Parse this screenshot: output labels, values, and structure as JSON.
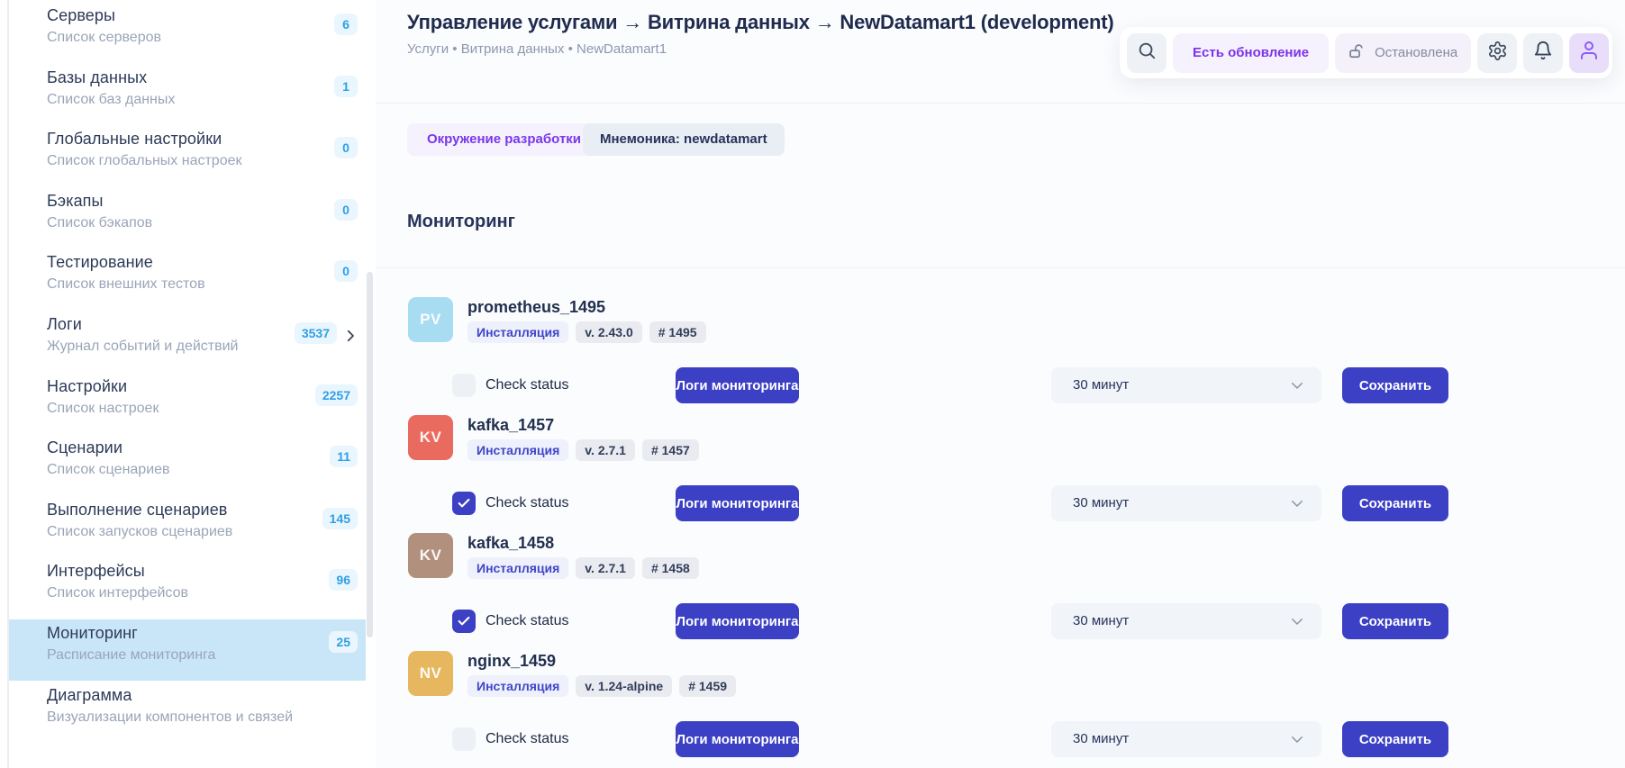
{
  "sidebar": {
    "items": [
      {
        "title": "Серверы",
        "subtitle": "Список серверов",
        "badge": "6"
      },
      {
        "title": "Базы данных",
        "subtitle": "Список баз данных",
        "badge": "1"
      },
      {
        "title": "Глобальные настройки",
        "subtitle": "Список глобальных настроек",
        "badge": "0"
      },
      {
        "title": "Бэкапы",
        "subtitle": "Список бэкапов",
        "badge": "0"
      },
      {
        "title": "Тестирование",
        "subtitle": "Список внешних тестов",
        "badge": "0"
      },
      {
        "title": "Логи",
        "subtitle": "Журнал событий и действий",
        "badge": "3537",
        "has_chevron": true
      },
      {
        "title": "Настройки",
        "subtitle": "Список настроек",
        "badge": "2257"
      },
      {
        "title": "Сценарии",
        "subtitle": "Список сценариев",
        "badge": "11"
      },
      {
        "title": "Выполнение сценариев",
        "subtitle": "Список запусков сценариев",
        "badge": "145"
      },
      {
        "title": "Интерфейсы",
        "subtitle": "Список интерфейсов",
        "badge": "96"
      },
      {
        "title": "Мониторинг",
        "subtitle": "Расписание мониторинга",
        "badge": "25",
        "selected": true
      },
      {
        "title": "Диаграмма",
        "subtitle": "Визуализации компонентов и связей",
        "badge": ""
      }
    ]
  },
  "header": {
    "title": "Управление услугами → Витрина данных → NewDatamart1 (development)",
    "breadcrumb": "Услуги • Витрина данных • NewDatamart1",
    "update_label": "Есть обновление",
    "status_label": "Остановлена"
  },
  "tags": {
    "environment": "Окружение разработки",
    "mnemonic": "Мнемоника: newdatamart"
  },
  "section": {
    "title": "Мониторинг"
  },
  "monitors": {
    "check_label": "Check status",
    "logs_button": "Логи мониторинга",
    "save_button": "Сохранить",
    "interval": "30 минут",
    "items": [
      {
        "name": "prometheus_1495",
        "initials": "PV",
        "avatar_color": "#a7dcf1",
        "status": "Инсталляция",
        "version": "v. 2.43.0",
        "number": "# 1495",
        "checked": false
      },
      {
        "name": "kafka_1457",
        "initials": "KV",
        "avatar_color": "#e96b60",
        "status": "Инсталляция",
        "version": "v. 2.7.1",
        "number": "# 1457",
        "checked": true
      },
      {
        "name": "kafka_1458",
        "initials": "KV",
        "avatar_color": "#b1907d",
        "status": "Инсталляция",
        "version": "v. 2.7.1",
        "number": "# 1458",
        "checked": true
      },
      {
        "name": "nginx_1459",
        "initials": "NV",
        "avatar_color": "#e6b75e",
        "status": "Инсталляция",
        "version": "v. 1.24-alpine",
        "number": "# 1459",
        "checked": false
      }
    ]
  },
  "icons": {
    "search": "magnifier",
    "status_lock": "lock-open",
    "settings": "gear",
    "notifications": "bell",
    "profile": "person",
    "sidebar_more": "chevron-right",
    "select_arrow": "chevron-down",
    "checkbox_check": "checkmark"
  },
  "colors": {
    "accent_indigo": "#3b40c4",
    "accent_purple": "#7c33ea",
    "badge_blue": "#2f9fe5",
    "selected_item_bg": "#c9e6f8"
  }
}
